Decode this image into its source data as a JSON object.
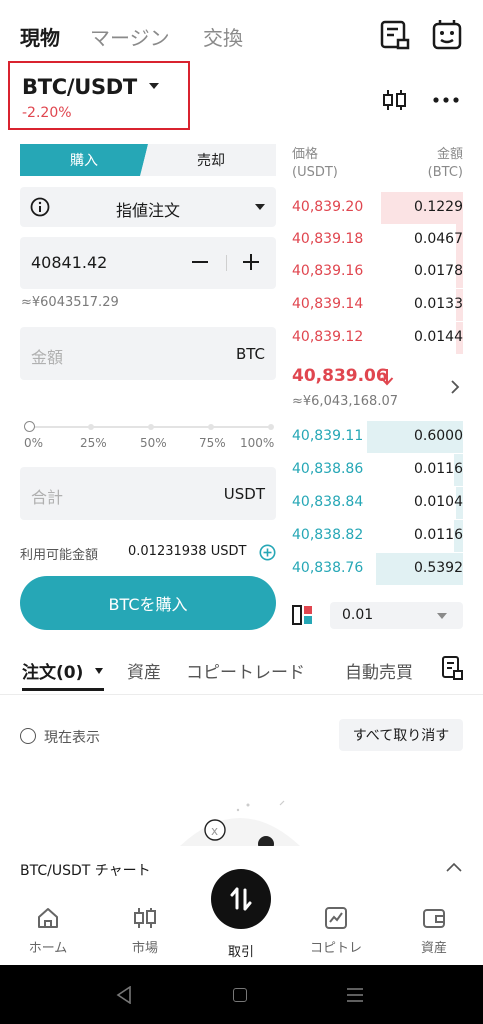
{
  "top_tabs": [
    "現物",
    "マージン",
    "交換"
  ],
  "pair": {
    "name": "BTC/USDT",
    "change": "-2.20%"
  },
  "trade_side": {
    "buy": "購入",
    "sell": "売却"
  },
  "order_type": "指値注文",
  "price_input": {
    "value": "40841.42",
    "approx": "≈¥6043517.29"
  },
  "amount_input": {
    "placeholder": "金額",
    "unit": "BTC"
  },
  "slider_ticks": [
    "0%",
    "25%",
    "50%",
    "75%",
    "100%"
  ],
  "slider_value_percent": 0,
  "total_input": {
    "placeholder": "合計",
    "unit": "USDT"
  },
  "available": {
    "label": "利用可能金額",
    "value": "0.01231938 USDT"
  },
  "buy_button": "BTCを購入",
  "order_book": {
    "price_header": [
      "価格",
      "(USDT)"
    ],
    "amount_header": [
      "金額",
      "(BTC)"
    ],
    "asks": [
      {
        "price": "40,839.20",
        "amount": "0.1229",
        "depth": 0.48
      },
      {
        "price": "40,839.18",
        "amount": "0.0467",
        "depth": 0.04
      },
      {
        "price": "40,839.16",
        "amount": "0.0178",
        "depth": 0.04
      },
      {
        "price": "40,839.14",
        "amount": "0.0133",
        "depth": 0.04
      },
      {
        "price": "40,839.12",
        "amount": "0.0144",
        "depth": 0.04
      }
    ],
    "last_price": "40,839.06",
    "last_price_jpy": "≈¥6,043,168.07",
    "bids": [
      {
        "price": "40,839.11",
        "amount": "0.6000",
        "depth": 0.56
      },
      {
        "price": "40,838.86",
        "amount": "0.0116",
        "depth": 0.05
      },
      {
        "price": "40,838.84",
        "amount": "0.0104",
        "depth": 0.04
      },
      {
        "price": "40,838.82",
        "amount": "0.0116",
        "depth": 0.05
      },
      {
        "price": "40,838.76",
        "amount": "0.5392",
        "depth": 0.51
      }
    ],
    "precision": "0.01"
  },
  "lower_tabs": [
    "注文(0)",
    "資産",
    "コピートレード",
    "自動売買"
  ],
  "current_display": "現在表示",
  "cancel_all": "すべて取り消す",
  "chart_bar": "BTC/USDT チャート",
  "bottom_nav": [
    "ホーム",
    "市場",
    "取引",
    "コピトレ",
    "資産"
  ],
  "colors": {
    "accent": "#26a7b6",
    "down": "#e0464f",
    "highlight_border": "#d9232f"
  }
}
